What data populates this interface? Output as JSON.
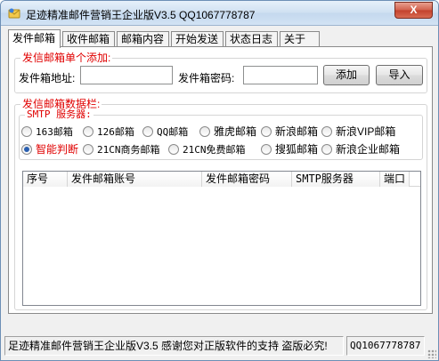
{
  "window": {
    "title": "足迹精准邮件营销王企业版V3.5 QQ1067778787",
    "close_glyph": "X"
  },
  "tabs": [
    {
      "label": "发件邮箱",
      "active": true
    },
    {
      "label": "收件邮箱",
      "active": false
    },
    {
      "label": "邮箱内容",
      "active": false
    },
    {
      "label": "开始发送",
      "active": false
    },
    {
      "label": "状态日志",
      "active": false
    },
    {
      "label": "关于",
      "active": false
    }
  ],
  "single_add": {
    "title": "发信邮箱单个添加:",
    "address_label": "发件箱地址:",
    "address_value": "",
    "password_label": "发件箱密码:",
    "password_value": "",
    "add_button": "添加",
    "import_button": "导入"
  },
  "data_section": {
    "title": "发信邮箱数据栏:",
    "smtp_title": "SMTP 服务器:",
    "smtp_options": [
      {
        "label": "163邮箱",
        "checked": false
      },
      {
        "label": "126邮箱",
        "checked": false
      },
      {
        "label": "QQ邮箱",
        "checked": false
      },
      {
        "label": "雅虎邮箱",
        "checked": false
      },
      {
        "label": "新浪邮箱",
        "checked": false
      },
      {
        "label": "新浪VIP邮箱",
        "checked": false
      },
      {
        "label": "智能判断",
        "checked": true
      },
      {
        "label": "21CN商务邮箱",
        "checked": false
      },
      {
        "label": "21CN免费邮箱",
        "checked": false
      },
      {
        "label": "搜狐邮箱",
        "checked": false
      },
      {
        "label": "新浪企业邮箱",
        "checked": false
      }
    ],
    "columns": [
      "序号",
      "发件邮箱账号",
      "发件邮箱密码",
      "SMTP服务器",
      "端口"
    ],
    "rows": []
  },
  "statusbar": {
    "message": "足迹精准邮件营销王企业版V3.5 感谢您对正版软件的支持 盗版必究!",
    "qq": "QQ1067778787"
  },
  "colors": {
    "accent_red": "#e00000",
    "radio_dot": "#2a5fb0"
  }
}
